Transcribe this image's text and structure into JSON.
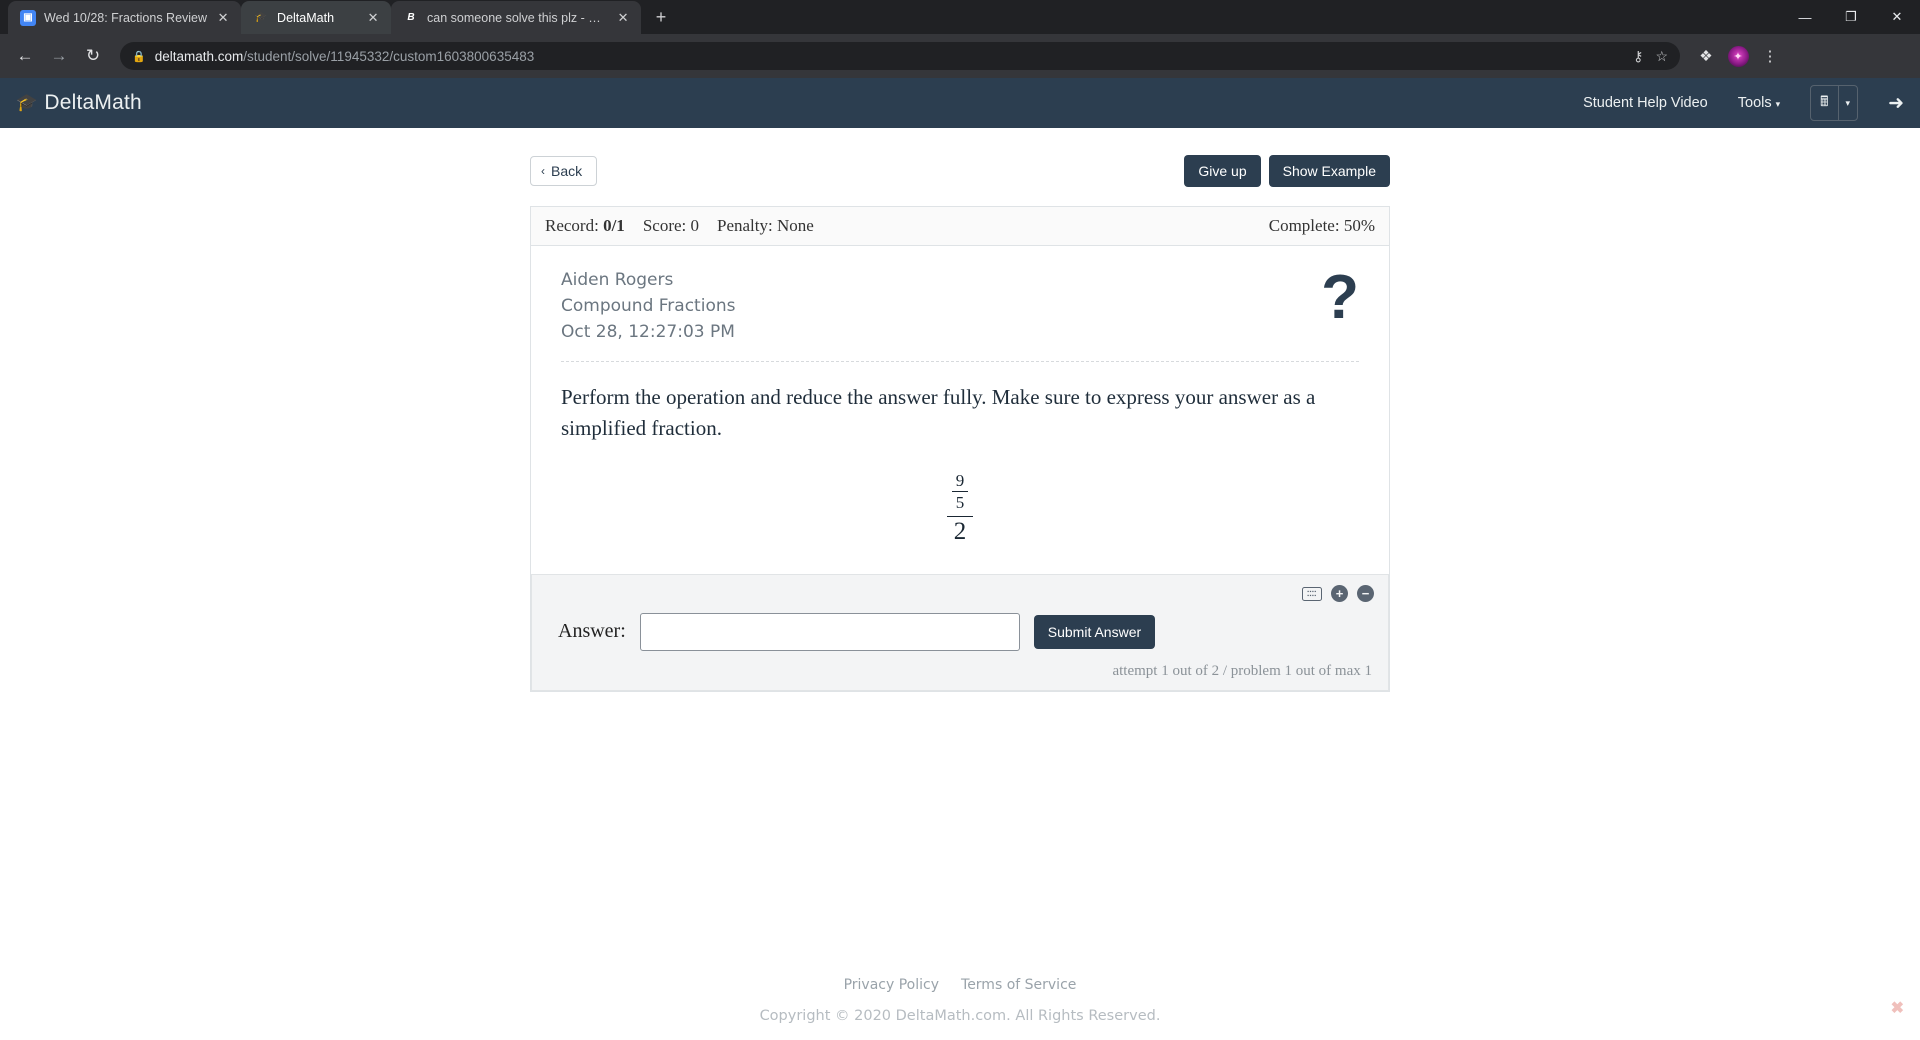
{
  "browser": {
    "tabs": [
      {
        "title": "Wed 10/28: Fractions Review",
        "favicon": "slides-icon",
        "active": false
      },
      {
        "title": "DeltaMath",
        "favicon": "deltamath-icon",
        "active": true
      },
      {
        "title": "can someone solve this plz - Brai",
        "favicon": "brainly-icon",
        "active": false
      }
    ],
    "new_tab_label": "+",
    "window_controls": {
      "minimize": "—",
      "maximize": "❐",
      "close": "✕"
    },
    "nav": {
      "back": "←",
      "forward": "→",
      "reload": "↻"
    },
    "omnibox": {
      "lock_icon": "lock-icon",
      "url_domain": "deltamath.com",
      "url_path": "/student/solve/11945332/custom1603800635483",
      "key_icon": "⚷",
      "star_icon": "☆"
    },
    "toolbar_icons": {
      "extensions": "❖",
      "profile": "✦",
      "menu": "⋮"
    }
  },
  "navbar": {
    "brand": "DeltaMath",
    "brand_icon": "graduation-cap-icon",
    "help_video": "Student Help Video",
    "tools": "Tools",
    "tools_caret": "▾",
    "calculator_icon": "calculator-icon",
    "calculator_caret": "▾",
    "logout_icon": "logout-icon"
  },
  "actions": {
    "back_label": "Back",
    "back_chevron": "‹",
    "give_up_label": "Give up",
    "show_example_label": "Show Example"
  },
  "status": {
    "record_label": "Record:",
    "record_value": "0/1",
    "score_label": "Score:",
    "score_value": "0",
    "penalty_label": "Penalty:",
    "penalty_value": "None",
    "complete_label": "Complete:",
    "complete_value": "50%"
  },
  "problem": {
    "student_name": "Aiden Rogers",
    "assignment": "Compound Fractions",
    "timestamp": "Oct 28, 12:27:03 PM",
    "help_icon": "?",
    "prompt": "Perform the operation and reduce the answer fully. Make sure to express your answer as a simplified fraction.",
    "expression": {
      "inner_numerator": "9",
      "inner_denominator": "5",
      "outer_denominator": "2"
    }
  },
  "answer_area": {
    "keyboard_icon": "keyboard-icon",
    "zoom_in_icon": "+",
    "zoom_out_icon": "−",
    "answer_label": "Answer:",
    "answer_value": "",
    "answer_placeholder": "",
    "submit_label": "Submit Answer",
    "attempt_text": "attempt 1 out of 2 / problem 1 out of max 1"
  },
  "footer": {
    "privacy": "Privacy Policy",
    "terms": "Terms of Service",
    "copyright": "Copyright © 2020 DeltaMath.com. All Rights Reserved.",
    "close_icon": "✖"
  },
  "colors": {
    "brand_navy": "#2c3e50",
    "chrome_dark": "#202124",
    "page_bg": "#ffffff"
  }
}
